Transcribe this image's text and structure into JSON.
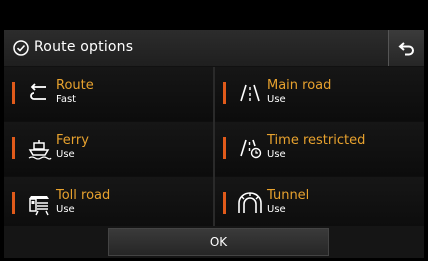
{
  "header": {
    "title": "Route options",
    "check_icon": "check-circle-icon",
    "back_icon": "back-arrow-icon"
  },
  "options": [
    {
      "label": "Route",
      "value": "Fast",
      "icon": "route-icon"
    },
    {
      "label": "Main road",
      "value": "Use",
      "icon": "main-road-icon"
    },
    {
      "label": "Ferry",
      "value": "Use",
      "icon": "ferry-icon"
    },
    {
      "label": "Time restricted",
      "value": "Use",
      "icon": "time-restricted-road-icon"
    },
    {
      "label": "Toll road",
      "value": "Use",
      "icon": "toll-road-icon"
    },
    {
      "label": "Tunnel",
      "value": "Use",
      "icon": "tunnel-icon"
    }
  ],
  "footer": {
    "ok_label": "OK"
  },
  "colors": {
    "accent_bar": "#e05a1a",
    "label": "#e8a22e",
    "value": "#ffffff",
    "background": "#0e0e0e"
  }
}
